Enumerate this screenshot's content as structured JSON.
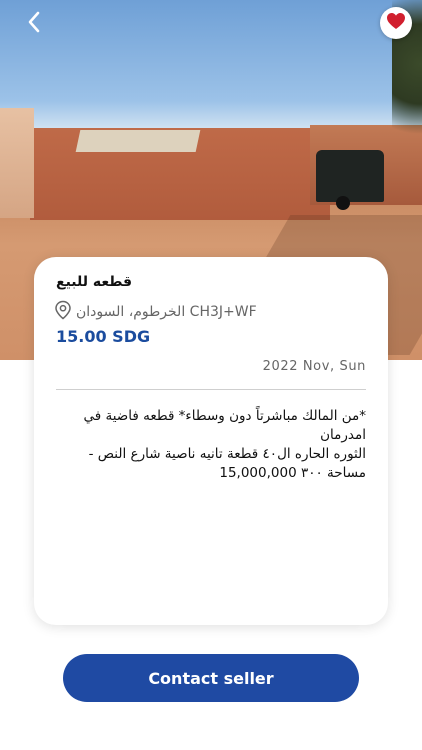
{
  "nav": {
    "back_icon": "chevron-left-icon",
    "favorite_icon": "heart-icon",
    "favorite_active": true,
    "favorite_color": "#d11f2e"
  },
  "listing": {
    "title": "قطعه للبيع",
    "location_icon": "map-pin-icon",
    "location": "الخرطوم، السودان CH3J+WF",
    "price": "15.00 SDG",
    "date": "2022 Nov, Sun",
    "description": "*من المالك مباشرتاً دون وسطاء* قطعه فاضية في امدرمان\nالثوره الحاره ال٤٠ قطعة تانيه ناصية شارع النص -\nمساحة ٣٠٠ 15,000,000"
  },
  "actions": {
    "contact_label": "Contact seller"
  },
  "colors": {
    "accent": "#1f4aa3",
    "price": "#1b4c9e",
    "heart": "#d11f2e"
  }
}
